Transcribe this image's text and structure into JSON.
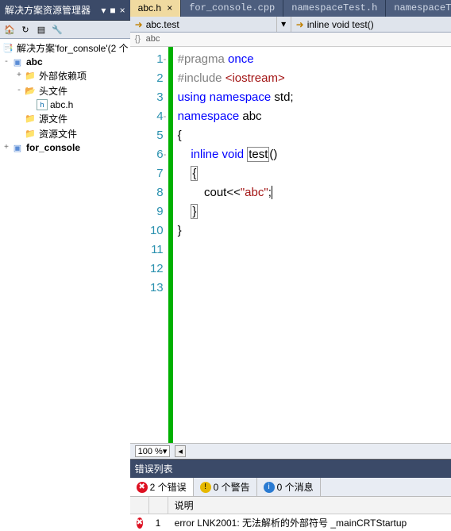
{
  "solutionExplorer": {
    "title": "解决方案资源管理器",
    "root": "解决方案'for_console'(2 个",
    "nodes": {
      "abc": "abc",
      "ext_deps": "外部依赖项",
      "headers": "头文件",
      "abc_h": "abc.h",
      "src": "源文件",
      "res": "资源文件",
      "for_console": "for_console"
    }
  },
  "tabs": [
    "abc.h",
    "for_console.cpp",
    "namespaceTest.h",
    "namespaceT"
  ],
  "nav": {
    "left": "abc.test",
    "right": "inline void test()"
  },
  "breadcrumb": "abc",
  "code": {
    "lines": [
      {
        "n": 1,
        "fold": "-",
        "tokens": [
          {
            "t": "#pragma",
            "c": "pp"
          },
          {
            "t": " "
          },
          {
            "t": "once",
            "c": "kw"
          }
        ]
      },
      {
        "n": 2,
        "tokens": []
      },
      {
        "n": 3,
        "tokens": [
          {
            "t": "#include",
            "c": "pp"
          },
          {
            "t": " "
          },
          {
            "t": "<iostream>",
            "c": "inc"
          }
        ]
      },
      {
        "n": 4,
        "tokens": []
      },
      {
        "n": 5,
        "tokens": [
          {
            "t": "using",
            "c": "kw"
          },
          {
            "t": " "
          },
          {
            "t": "namespace",
            "c": "kw"
          },
          {
            "t": " std;"
          }
        ]
      },
      {
        "n": 6,
        "tokens": []
      },
      {
        "n": 7,
        "fold": "-",
        "tokens": [
          {
            "t": "namespace",
            "c": "kw"
          },
          {
            "t": " abc"
          }
        ]
      },
      {
        "n": 8,
        "tokens": [
          {
            "t": "{"
          }
        ]
      },
      {
        "n": 9,
        "fold": "-",
        "tokens": [
          {
            "t": "    "
          },
          {
            "t": "inline",
            "c": "kw"
          },
          {
            "t": " "
          },
          {
            "t": "void",
            "c": "kw"
          },
          {
            "t": " "
          },
          {
            "t": "test",
            "c": "boxed"
          },
          {
            "t": "()"
          }
        ]
      },
      {
        "n": 10,
        "tokens": [
          {
            "t": "    "
          },
          {
            "t": "{",
            "c": "boxed"
          }
        ]
      },
      {
        "n": 11,
        "tokens": [
          {
            "t": "        cout<<"
          },
          {
            "t": "\"abc\"",
            "c": "str"
          },
          {
            "t": ";",
            "cursor": true
          }
        ]
      },
      {
        "n": 12,
        "tokens": [
          {
            "t": "    "
          },
          {
            "t": "}",
            "c": "boxed"
          }
        ]
      },
      {
        "n": 13,
        "tokens": [
          {
            "t": "}"
          }
        ]
      }
    ]
  },
  "zoom": "100 %",
  "errorList": {
    "title": "错误列表",
    "tabs": {
      "errors": "2 个错误",
      "warnings": "0 个警告",
      "messages": "0 个消息"
    },
    "headers": [
      "",
      "",
      "说明"
    ],
    "rows": [
      {
        "icon": "err",
        "num": "1",
        "desc": "error LNK2001: 无法解析的外部符号 _mainCRTStartup"
      }
    ]
  }
}
